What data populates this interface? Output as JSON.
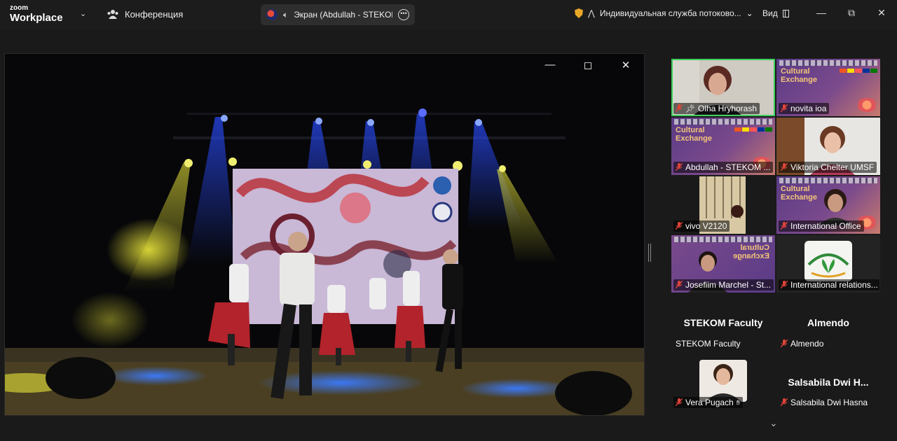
{
  "app": {
    "logo_line1": "zoom",
    "logo_line2": "Workplace",
    "meeting_label": "Конференция",
    "share_label": "Экран (Abdullah - STEKOM I",
    "stream_label": "Индивидуальная служба потоково...",
    "view_label": "Вид"
  },
  "participants": [
    {
      "name": "Olha Hryhorash",
      "type": "video",
      "mic": "off",
      "pinned": true,
      "active": true
    },
    {
      "name": "novita ioa",
      "type": "slide",
      "mic": "off"
    },
    {
      "name": "Abdullah - STEKOM ...",
      "type": "slide",
      "mic": "off"
    },
    {
      "name": "Viktoria Chelter UMSF",
      "type": "video",
      "mic": "off"
    },
    {
      "name": "vivo V2120",
      "type": "video",
      "mic": "off"
    },
    {
      "name": "International Office",
      "type": "slide",
      "mic": "off"
    },
    {
      "name": "Josefiim Marchel - St...",
      "type": "slide-mirror",
      "mic": "off"
    },
    {
      "name": "International relations...",
      "type": "logo",
      "mic": "off"
    },
    {
      "name": "STEKOM Faculty",
      "big": "STEKOM Faculty",
      "type": "name",
      "mic": "none"
    },
    {
      "name": "Almendo",
      "big": "Almendo",
      "type": "name",
      "mic": "off"
    },
    {
      "name": "Vera Pugach",
      "type": "photo",
      "mic": "off"
    },
    {
      "name": "Salsabila Dwi Hasna",
      "big": "Salsabila  Dwi  H...",
      "type": "name",
      "mic": "off"
    }
  ],
  "slide_text": {
    "line1": "Cultural",
    "line2": "Exchange"
  },
  "colors": {
    "accent_active": "#3fcf5f",
    "mic_off": "#e0443a",
    "background": "#1a1a1a"
  }
}
